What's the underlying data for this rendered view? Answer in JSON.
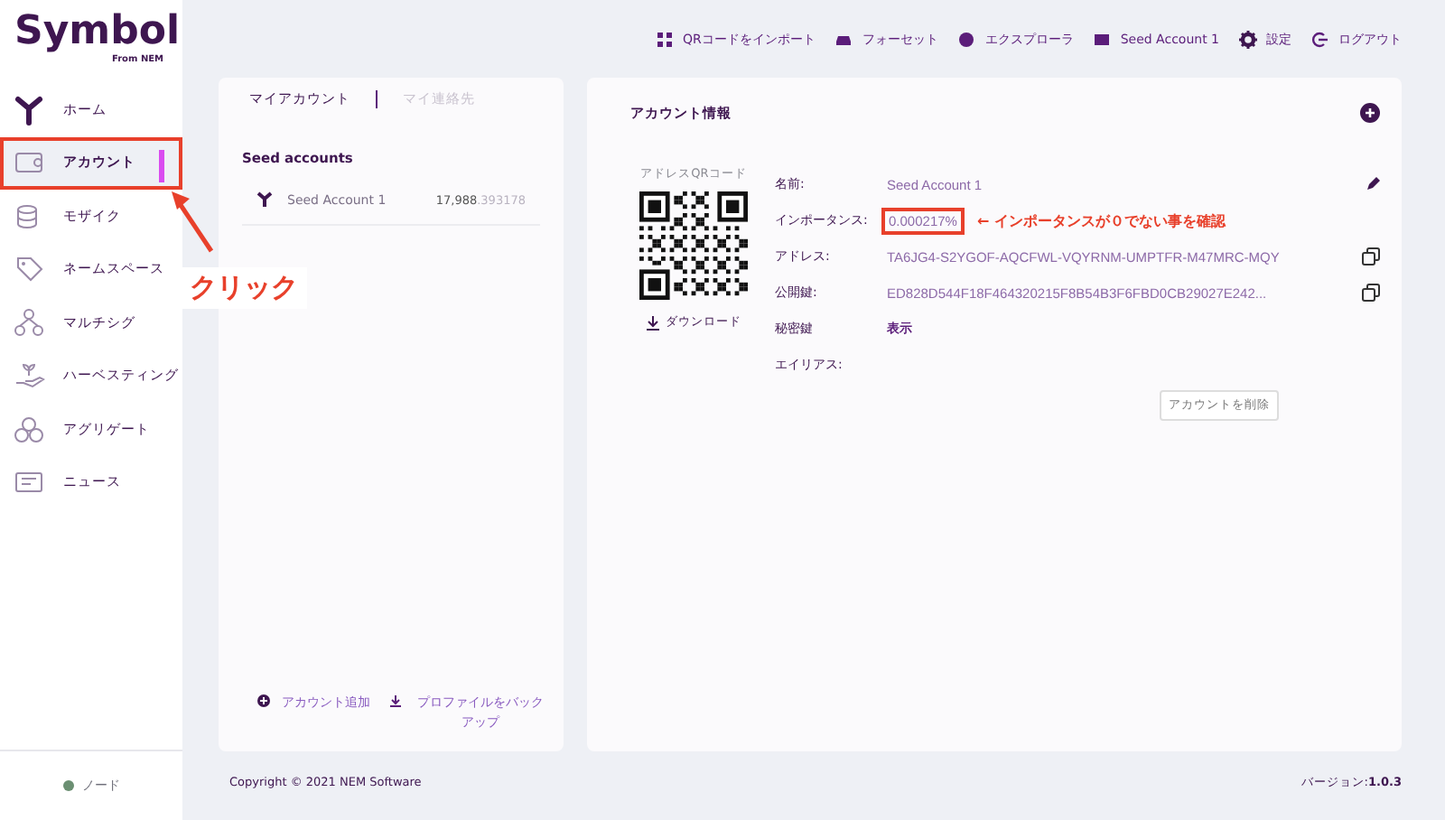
{
  "logo": {
    "title": "Symbol",
    "subtitle": "From NEM"
  },
  "sidebar": {
    "items": [
      {
        "label": "ホーム",
        "selected": false,
        "highlighted": false
      },
      {
        "label": "アカウント",
        "selected": true,
        "highlighted": true
      },
      {
        "label": "モザイク",
        "selected": false,
        "highlighted": false
      },
      {
        "label": "ネームスペース",
        "selected": false,
        "highlighted": false
      },
      {
        "label": "マルチシグ",
        "selected": false,
        "highlighted": false
      },
      {
        "label": "ハーベスティング",
        "selected": false,
        "highlighted": false
      },
      {
        "label": "アグリゲート",
        "selected": false,
        "highlighted": false
      },
      {
        "label": "ニュース",
        "selected": false,
        "highlighted": false
      }
    ],
    "node": {
      "label": "ノード",
      "color": "#6b8f72"
    }
  },
  "header": {
    "items": [
      "QRコードをインポート",
      "フォーセット",
      "エクスプローラ",
      "Seed Account 1",
      "設定",
      "ログアウト"
    ]
  },
  "accounts_panel": {
    "tabs": [
      {
        "label": "マイアカウント",
        "selected": true
      },
      {
        "label": "マイ連絡先",
        "selected": false
      }
    ],
    "section": "Seed accounts",
    "accounts": [
      {
        "name": "Seed Account 1",
        "balance_whole": "17,988",
        "balance_fraction": ".393178"
      }
    ],
    "actions": [
      "アカウント追加",
      "プロファイルをバックアップ"
    ]
  },
  "account_info": {
    "title": "アカウント情報",
    "qr_label": "アドレスQRコード",
    "download": "ダウンロード",
    "fields": [
      {
        "label": "名前:",
        "value": "Seed Account 1",
        "kind": "edit",
        "highlighted": false
      },
      {
        "label": "インポータンス:",
        "value": "0.000217%",
        "kind": "plain",
        "highlighted": true
      },
      {
        "label": "アドレス:",
        "value": "TA6JG4-S2YGOF-AQCFWL-VQYRNM-UMPTFR-M47MRC-MQY",
        "kind": "copy",
        "highlighted": false
      },
      {
        "label": "公開鍵:",
        "value": "ED828D544F18F464320215F8B54B3F6FBD0CB29027E242...",
        "kind": "copy",
        "highlighted": false
      },
      {
        "label": "秘密鍵",
        "value": "表示",
        "kind": "link",
        "highlighted": false
      },
      {
        "label": "エイリアス:",
        "kind": "plain",
        "highlighted": false
      }
    ],
    "delete_button": "アカウントを削除"
  },
  "annotations": {
    "click_label": "クリック",
    "importance_note": "← インポータンスが０でない事を確認"
  },
  "footer": {
    "copyright": "Copyright © 2021 NEM Software",
    "version_label": "バージョン:",
    "version": "1.0.3"
  }
}
